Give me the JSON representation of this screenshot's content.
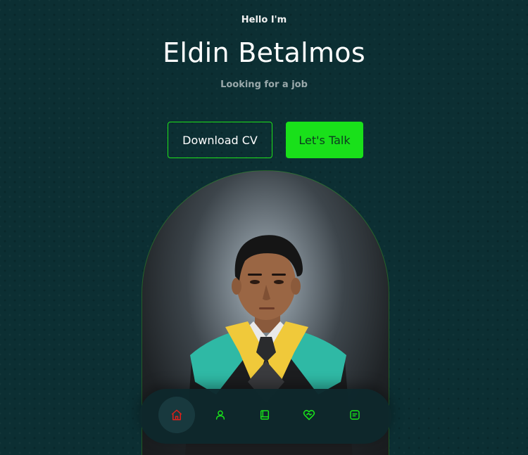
{
  "hero": {
    "greeting": "Hello I'm",
    "name": "Eldin Betalmos",
    "subtitle": "Looking for a job"
  },
  "buttons": {
    "download_cv": "Download CV",
    "lets_talk": "Let's Talk"
  },
  "profile_photo": {
    "alt": "Graduation portrait"
  },
  "nav": {
    "items": [
      {
        "icon": "home-icon",
        "active": true
      },
      {
        "icon": "user-icon",
        "active": false
      },
      {
        "icon": "book-icon",
        "active": false
      },
      {
        "icon": "heart-handshake-icon",
        "active": false
      },
      {
        "icon": "message-icon",
        "active": false
      }
    ]
  },
  "colors": {
    "background": "#0c2f33",
    "accent_green": "#19e01a",
    "active_icon_red": "#e0201a",
    "nav_background": "#0e282c"
  }
}
